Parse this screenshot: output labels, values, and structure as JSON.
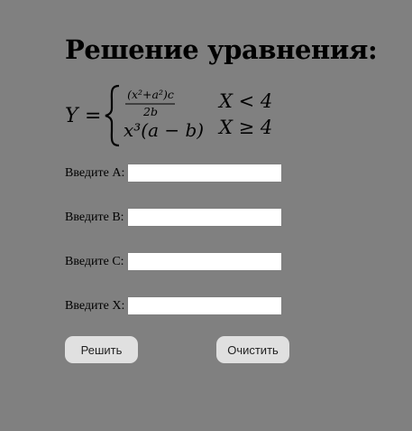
{
  "page": {
    "title": "Решение уравнения:"
  },
  "formula": {
    "lhs": "Y",
    "equals": "=",
    "case1": {
      "numerator": "(x²+a²)c",
      "denominator": "2b",
      "condition": "X < 4"
    },
    "case2": {
      "expression": "x³(a − b)",
      "condition": "X ≥ 4"
    }
  },
  "form": {
    "fields": [
      {
        "label": "Введите А:",
        "value": ""
      },
      {
        "label": "Введите В:",
        "value": ""
      },
      {
        "label": "Введите С:",
        "value": ""
      },
      {
        "label": "Введите Х:",
        "value": ""
      }
    ],
    "solve_label": "Решить",
    "clear_label": "Очистить"
  },
  "colors": {
    "background": "#808080",
    "input_background": "#ffffff",
    "button_background": "#e0e0e0"
  }
}
